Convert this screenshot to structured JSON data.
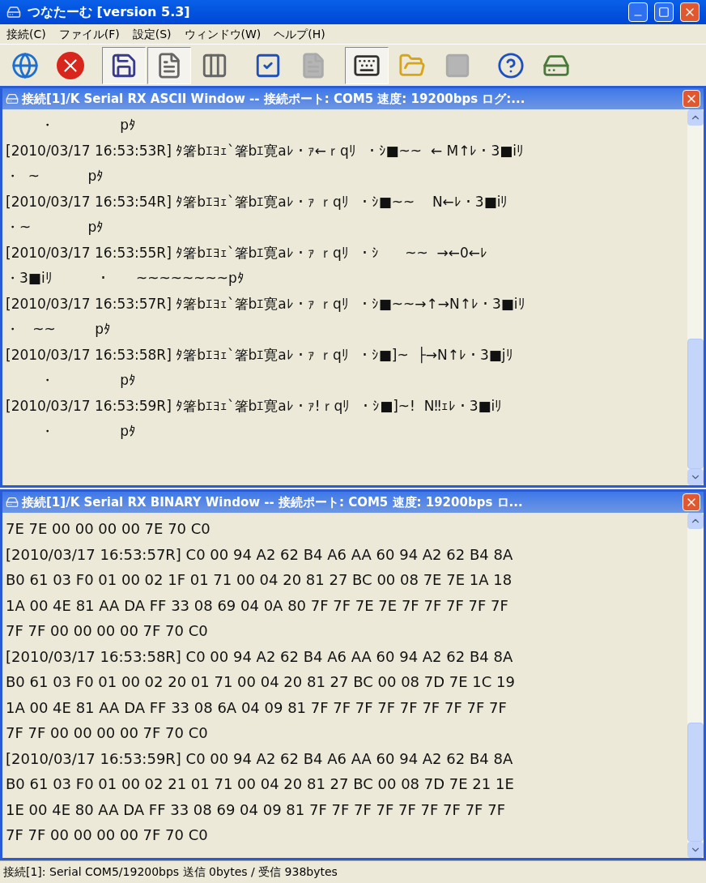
{
  "window": {
    "title": "つなたーむ [version 5.3]"
  },
  "menu": [
    "接続(C)",
    "ファイル(F)",
    "設定(S)",
    "ウィンドウ(W)",
    "ヘルプ(H)"
  ],
  "toolbar": [
    [
      {
        "kind": "globe",
        "pressed": false,
        "disabled": false
      },
      {
        "kind": "stop",
        "pressed": false,
        "disabled": false
      }
    ],
    [
      {
        "kind": "disk",
        "pressed": true,
        "disabled": false
      },
      {
        "kind": "page",
        "pressed": true,
        "disabled": false
      },
      {
        "kind": "columns",
        "pressed": false,
        "disabled": false
      }
    ],
    [
      {
        "kind": "check",
        "pressed": false,
        "disabled": false
      },
      {
        "kind": "page",
        "pressed": false,
        "disabled": true
      }
    ],
    [
      {
        "kind": "keyboard",
        "pressed": true,
        "disabled": false
      },
      {
        "kind": "folder",
        "pressed": false,
        "disabled": false
      },
      {
        "kind": "blank",
        "pressed": false,
        "disabled": true
      }
    ],
    [
      {
        "kind": "help",
        "pressed": false,
        "disabled": false
      },
      {
        "kind": "drum",
        "pressed": false,
        "disabled": false
      }
    ]
  ],
  "ascii_window": {
    "title": "接続[1]/K Serial RX ASCII Window -- 接続ポート: COM5 速度: 19200bps ログ:...",
    "lines": [
      "        ・               pﾀ",
      "[2010/03/17 16:53:53R] ﾀ箸bｴﾖｪ`箸bｴ寛aﾚ・ｧ←ｒqﾘ  ・ｼ■~~  ← M↑ﾚ・3■iﾘ",
      "・  ~           pﾀ",
      "[2010/03/17 16:53:54R] ﾀ箸bｴﾖｪ`箸bｴ寛aﾚ・ｧ ｒqﾘ  ・ｼ■~~    N←ﾚ・3■iﾘ",
      "・~             pﾀ",
      "[2010/03/17 16:53:55R] ﾀ箸bｴﾖｪ`箸bｴ寛aﾚ・ｧ ｒqﾘ  ・ｼ      ~~  →←0←ﾚ",
      "・3■iﾘ          ・      ~~~~~~~~pﾀ",
      "[2010/03/17 16:53:57R] ﾀ箸bｴﾖｪ`箸bｴ寛aﾚ・ｧ ｒqﾘ  ・ｼ■~~→↑→N↑ﾚ・3■iﾘ",
      "・   ~~         pﾀ",
      "[2010/03/17 16:53:58R] ﾀ箸bｴﾖｪ`箸bｴ寛aﾚ・ｧ ｒqﾘ  ・ｼ■]~  ├→N↑ﾚ・3■jﾘ",
      "        ・               pﾀ",
      "[2010/03/17 16:53:59R] ﾀ箸bｴﾖｪ`箸bｴ寛aﾚ・ｧ!ｒqﾘ  ・ｼ■]~!  N‼ｪﾚ・3■iﾘ",
      "        ・               pﾀ"
    ]
  },
  "binary_window": {
    "title": "接続[1]/K Serial RX BINARY Window -- 接続ポート: COM5 速度: 19200bps ロ...",
    "lines": [
      "7E 7E 00 00 00 00 7E 70 C0",
      "[2010/03/17 16:53:57R] C0 00 94 A2 62 B4 A6 AA 60 94 A2 62 B4 8A",
      "B0 61 03 F0 01 00 02 1F 01 71 00 04 20 81 27 BC 00 08 7E 7E 1A 18",
      "1A 00 4E 81 AA DA FF 33 08 69 04 0A 80 7F 7F 7E 7E 7F 7F 7F 7F 7F",
      "7F 7F 00 00 00 00 7F 70 C0",
      "[2010/03/17 16:53:58R] C0 00 94 A2 62 B4 A6 AA 60 94 A2 62 B4 8A",
      "B0 61 03 F0 01 00 02 20 01 71 00 04 20 81 27 BC 00 08 7D 7E 1C 19",
      "1A 00 4E 81 AA DA FF 33 08 6A 04 09 81 7F 7F 7F 7F 7F 7F 7F 7F 7F",
      "7F 7F 00 00 00 00 7F 70 C0",
      "[2010/03/17 16:53:59R] C0 00 94 A2 62 B4 A6 AA 60 94 A2 62 B4 8A",
      "B0 61 03 F0 01 00 02 21 01 71 00 04 20 81 27 BC 00 08 7D 7E 21 1E",
      "1E 00 4E 80 AA DA FF 33 08 69 04 09 81 7F 7F 7F 7F 7F 7F 7F 7F 7F",
      "7F 7F 00 00 00 00 7F 70 C0"
    ]
  },
  "status_bar": "接続[1]: Serial COM5/19200bps 送信 0bytes / 受信 938bytes"
}
